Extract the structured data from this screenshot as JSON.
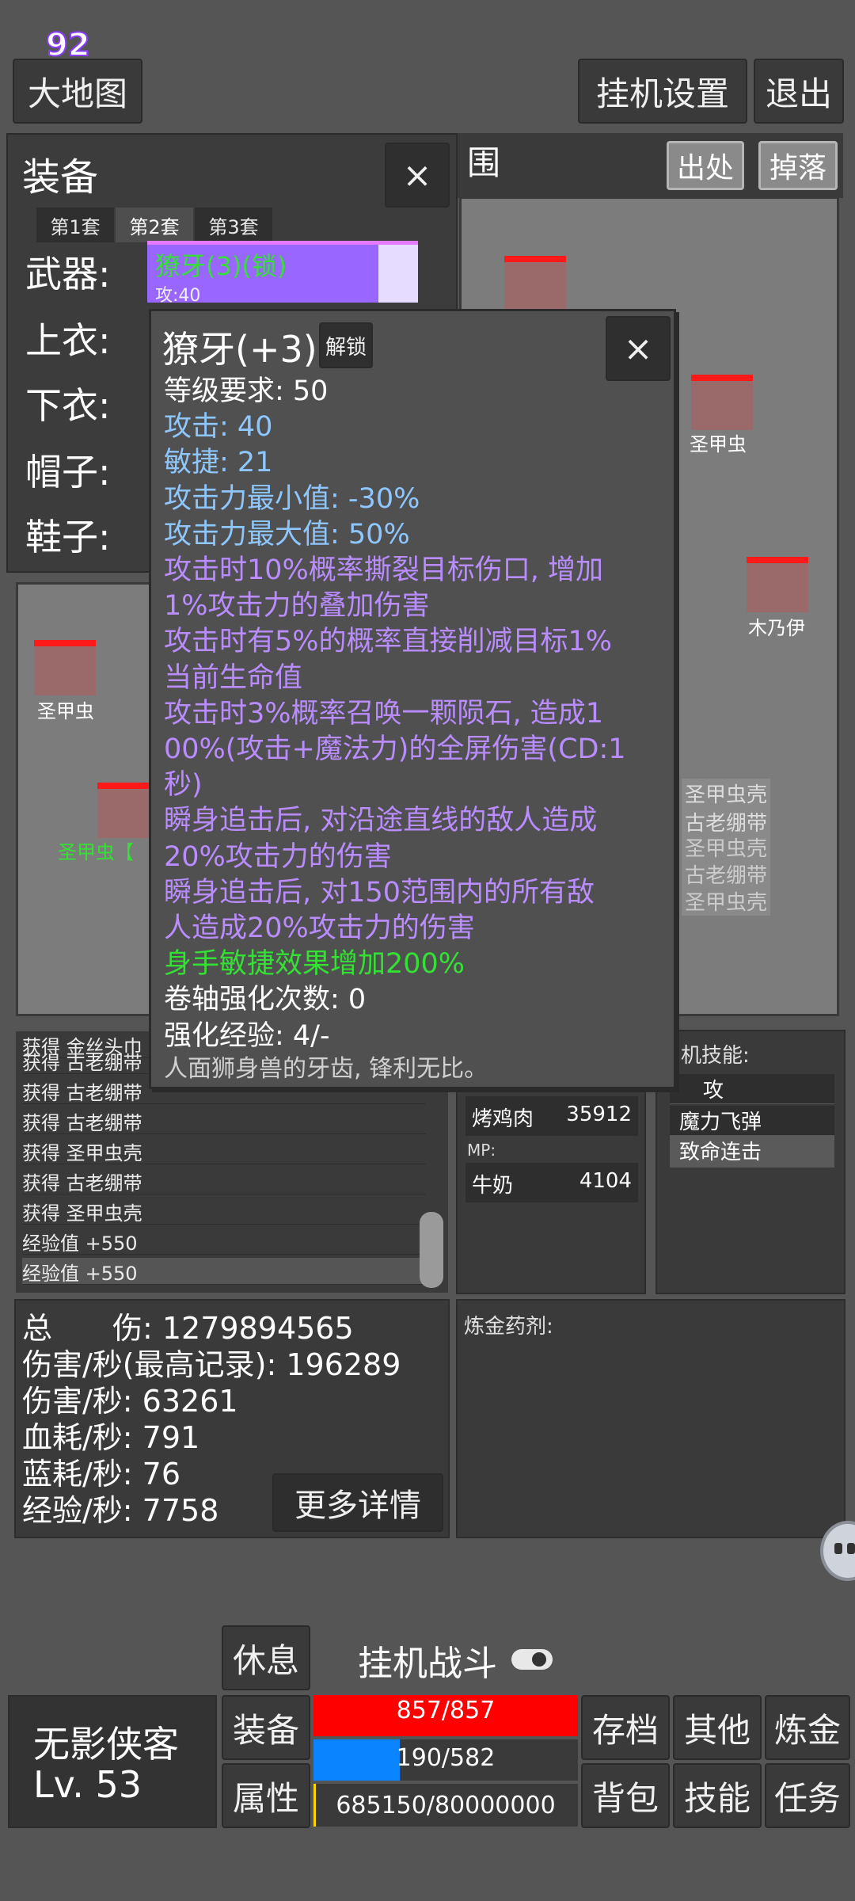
{
  "floating_numbers": [
    "92"
  ],
  "header": {
    "map_button": "大地图",
    "idle_settings_button": "挂机设置",
    "exit_button": "退出"
  },
  "map": {
    "range_title": "围",
    "source_button": "出处",
    "drop_button": "掉落",
    "monsters": [
      {
        "name": "圣甲虫"
      },
      {
        "name": "木乃伊"
      },
      {
        "name": "圣甲虫"
      },
      {
        "name": "圣甲虫【"
      }
    ],
    "drop_labels": [
      "圣甲虫壳",
      "古老绷带",
      "圣甲虫壳",
      "古老绷带",
      "圣甲虫壳"
    ]
  },
  "equipment": {
    "title": "装备",
    "close": "×",
    "tabs": [
      "第1套",
      "第2套",
      "第3套"
    ],
    "active_tab": "第2套",
    "slots": [
      "武器:",
      "上衣:",
      "下衣:",
      "帽子:",
      "鞋子:"
    ],
    "weapon_item": {
      "name": "獠牙(3)(锁)",
      "sub": "攻:40"
    }
  },
  "tooltip": {
    "title": "獠牙(+3)",
    "unlock_button": "解锁",
    "close": "×",
    "lines": [
      {
        "text": "等级要求: 50",
        "color": "white"
      },
      {
        "text": "攻击: 40",
        "color": "blue"
      },
      {
        "text": "敏捷: 21",
        "color": "blue"
      },
      {
        "text": "攻击力最小值: -30%",
        "color": "blue"
      },
      {
        "text": "攻击力最大值: 50%",
        "color": "blue"
      },
      {
        "text": "攻击时10%概率撕裂目标伤口, 增加",
        "color": "purple"
      },
      {
        "text": "1%攻击力的叠加伤害",
        "color": "purple"
      },
      {
        "text": "攻击时有5%的概率直接削减目标1%",
        "color": "purple"
      },
      {
        "text": "当前生命值",
        "color": "purple"
      },
      {
        "text": "攻击时3%概率召唤一颗陨石, 造成1",
        "color": "purple"
      },
      {
        "text": "00%(攻击+魔法力)的全屏伤害(CD:1",
        "color": "purple"
      },
      {
        "text": "秒)",
        "color": "purple"
      },
      {
        "text": "瞬身追击后, 对沿途直线的敌人造成",
        "color": "purple"
      },
      {
        "text": "20%攻击力的伤害",
        "color": "purple"
      },
      {
        "text": "瞬身追击后, 对150范围内的所有敌",
        "color": "purple"
      },
      {
        "text": "人造成20%攻击力的伤害",
        "color": "purple"
      },
      {
        "text": "身手敏捷效果增加200%",
        "color": "green"
      },
      {
        "text": "卷轴强化次数: 0",
        "color": "white"
      },
      {
        "text": "强化经验: 4/-",
        "color": "white"
      },
      {
        "text": "人面狮身兽的牙齿, 锋利无比。",
        "color": "grey"
      }
    ]
  },
  "log": {
    "rows": [
      "获得 金丝头巾",
      "获得 古老绷带",
      "获得 古老绷带",
      "获得 古老绷带",
      "获得 圣甲虫壳",
      "获得 古老绷带",
      "获得 圣甲虫壳",
      "经验值 +550",
      "经验值 +550"
    ]
  },
  "potions": {
    "hp_item": {
      "name": "烤鸡肉",
      "count": "35912"
    },
    "mp_label": "MP:",
    "mp_item": {
      "name": "牛奶",
      "count": "4104"
    }
  },
  "skills": {
    "title": "机技能:",
    "items": [
      "攻",
      "魔力飞弹",
      "致命连击"
    ]
  },
  "stats": {
    "total_damage": "总　　伤: 1279894565",
    "dps_record": "伤害/秒(最高记录): 196289",
    "dps": "伤害/秒: 63261",
    "hp_cost": "血耗/秒: 791",
    "mp_cost": "蓝耗/秒: 76",
    "exp_rate": "经验/秒: 7758",
    "more_button": "更多详情"
  },
  "alchemy": {
    "title": "炼金药剂:"
  },
  "bottom": {
    "rest_button": "休息",
    "idle_fight_label": "挂机战斗",
    "character_name": "无影侠客",
    "level": "Lv. 53",
    "equip_button": "装备",
    "attr_button": "属性",
    "hp_text": "857/857",
    "hp_fraction": 1.0,
    "mp_text": "190/582",
    "mp_fraction": 0.3265,
    "exp_text": "685150/80000000",
    "exp_fraction": 0.0086,
    "save_button": "存档",
    "other_button": "其他",
    "alchemy_button": "炼金",
    "bag_button": "背包",
    "skill_button": "技能",
    "task_button": "任务"
  },
  "colors": {
    "hp": "#ff0000",
    "mp": "#0a84ff",
    "purple_item": "#9966ff",
    "green_text": "#35e035"
  }
}
